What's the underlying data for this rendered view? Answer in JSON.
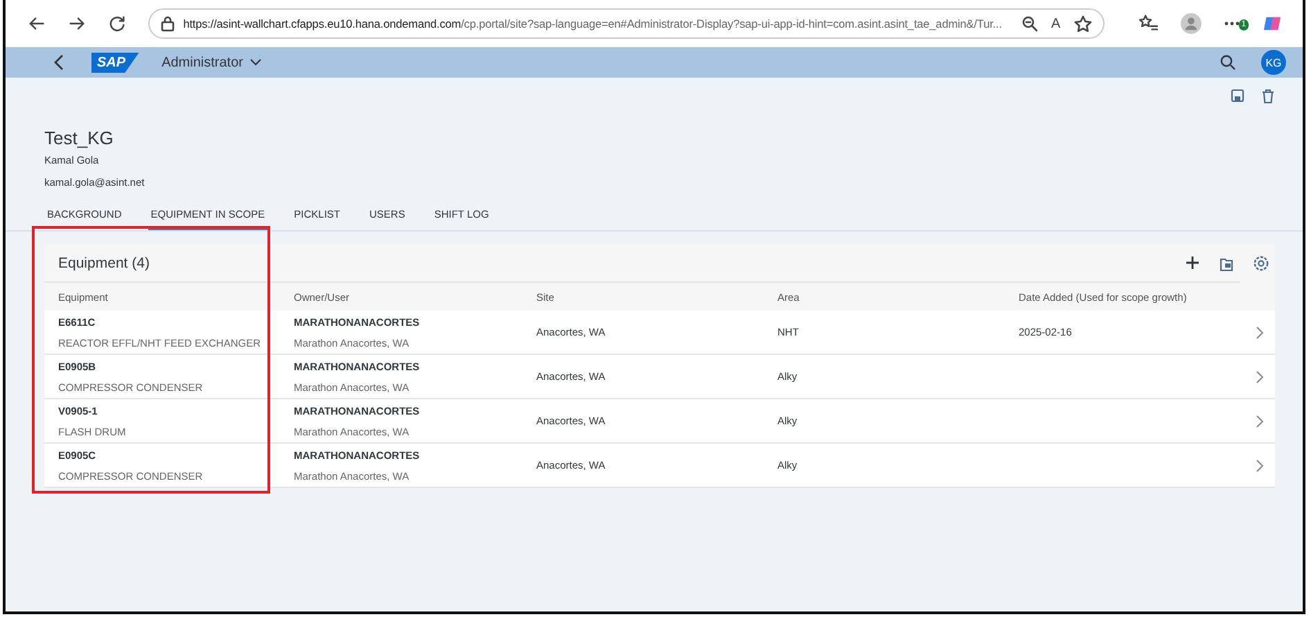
{
  "browser": {
    "url_host": "https://asint-wallchart.cfapps.eu10.hana.ondemand.com",
    "url_rest": "/cp.portal/site?sap-language=en#Administrator-Display?sap-ui-app-id-hint=com.asint.asint_tae_admin&/Tur...",
    "read_aloud": "A",
    "notification_count": "1"
  },
  "shell": {
    "logo": "SAP",
    "title": "Administrator",
    "avatar": "KG"
  },
  "header": {
    "title": "Test_KG",
    "subtitle": "Kamal Gola",
    "email": "kamal.gola@asint.net"
  },
  "tabs": [
    {
      "label": "BACKGROUND",
      "selected": false
    },
    {
      "label": "EQUIPMENT IN SCOPE",
      "selected": true
    },
    {
      "label": "PICKLIST",
      "selected": false
    },
    {
      "label": "USERS",
      "selected": false
    },
    {
      "label": "SHIFT LOG",
      "selected": false
    }
  ],
  "table": {
    "title": "Equipment (4)",
    "columns": [
      "Equipment",
      "Owner/User",
      "Site",
      "Area",
      "Date Added (Used for scope growth)"
    ],
    "rows": [
      {
        "equipment": "E6611C",
        "description": "REACTOR EFFL/NHT FEED EXCHANGER",
        "owner": "MARATHONANACORTES",
        "owner_name": "Marathon Anacortes, WA",
        "site": "Anacortes, WA",
        "area": "NHT",
        "date_added": "2025-02-16"
      },
      {
        "equipment": "E0905B",
        "description": "COMPRESSOR CONDENSER",
        "owner": "MARATHONANACORTES",
        "owner_name": "Marathon Anacortes, WA",
        "site": "Anacortes, WA",
        "area": "Alky"
      },
      {
        "equipment": "V0905-1",
        "description": "FLASH DRUM",
        "owner": "MARATHONANACORTES",
        "owner_name": "Marathon Anacortes, WA",
        "site": "Anacortes, WA",
        "area": "Alky"
      },
      {
        "equipment": "E0905C",
        "description": "COMPRESSOR CONDENSER",
        "owner": "MARATHONANACORTES",
        "owner_name": "Marathon Anacortes, WA",
        "site": "Anacortes, WA",
        "area": "Alky"
      }
    ]
  }
}
